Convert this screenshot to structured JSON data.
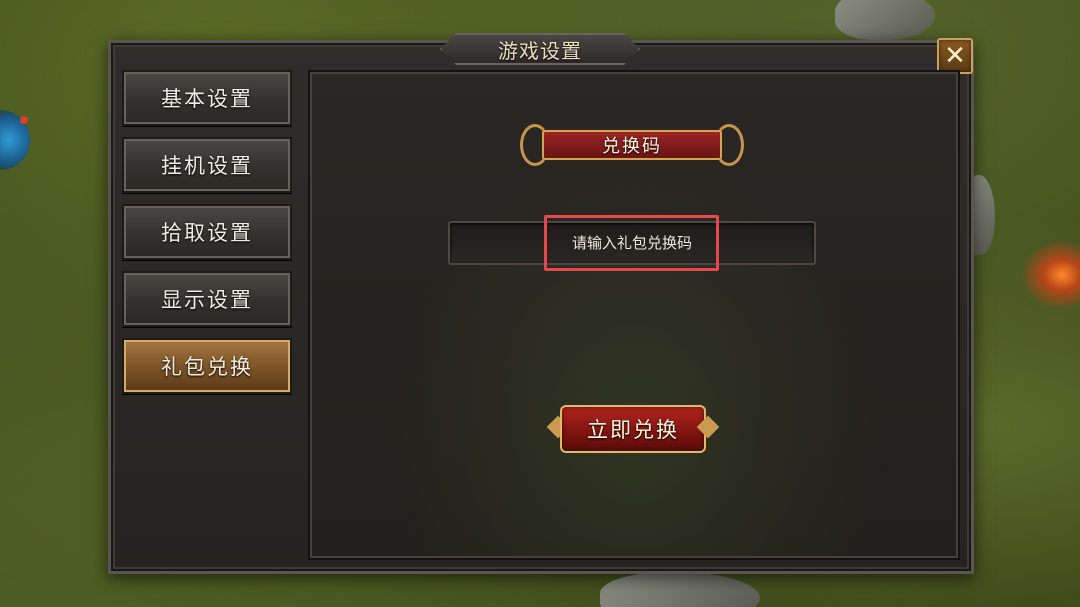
{
  "window": {
    "title": "游戏设置",
    "close_label": "✕"
  },
  "sidebar": {
    "items": [
      {
        "label": "基本设置",
        "active": false
      },
      {
        "label": "挂机设置",
        "active": false
      },
      {
        "label": "拾取设置",
        "active": false
      },
      {
        "label": "显示设置",
        "active": false
      },
      {
        "label": "礼包兑换",
        "active": true
      }
    ]
  },
  "redeem": {
    "section_title": "兑换码",
    "input_placeholder": "请输入礼包兑换码",
    "input_value": "",
    "submit_label": "立即兑换"
  },
  "colors": {
    "accent_gold": "#c9a15a",
    "button_red": "#b3261e",
    "highlight_box": "#e5474c",
    "active_tab": "#a7783f"
  }
}
